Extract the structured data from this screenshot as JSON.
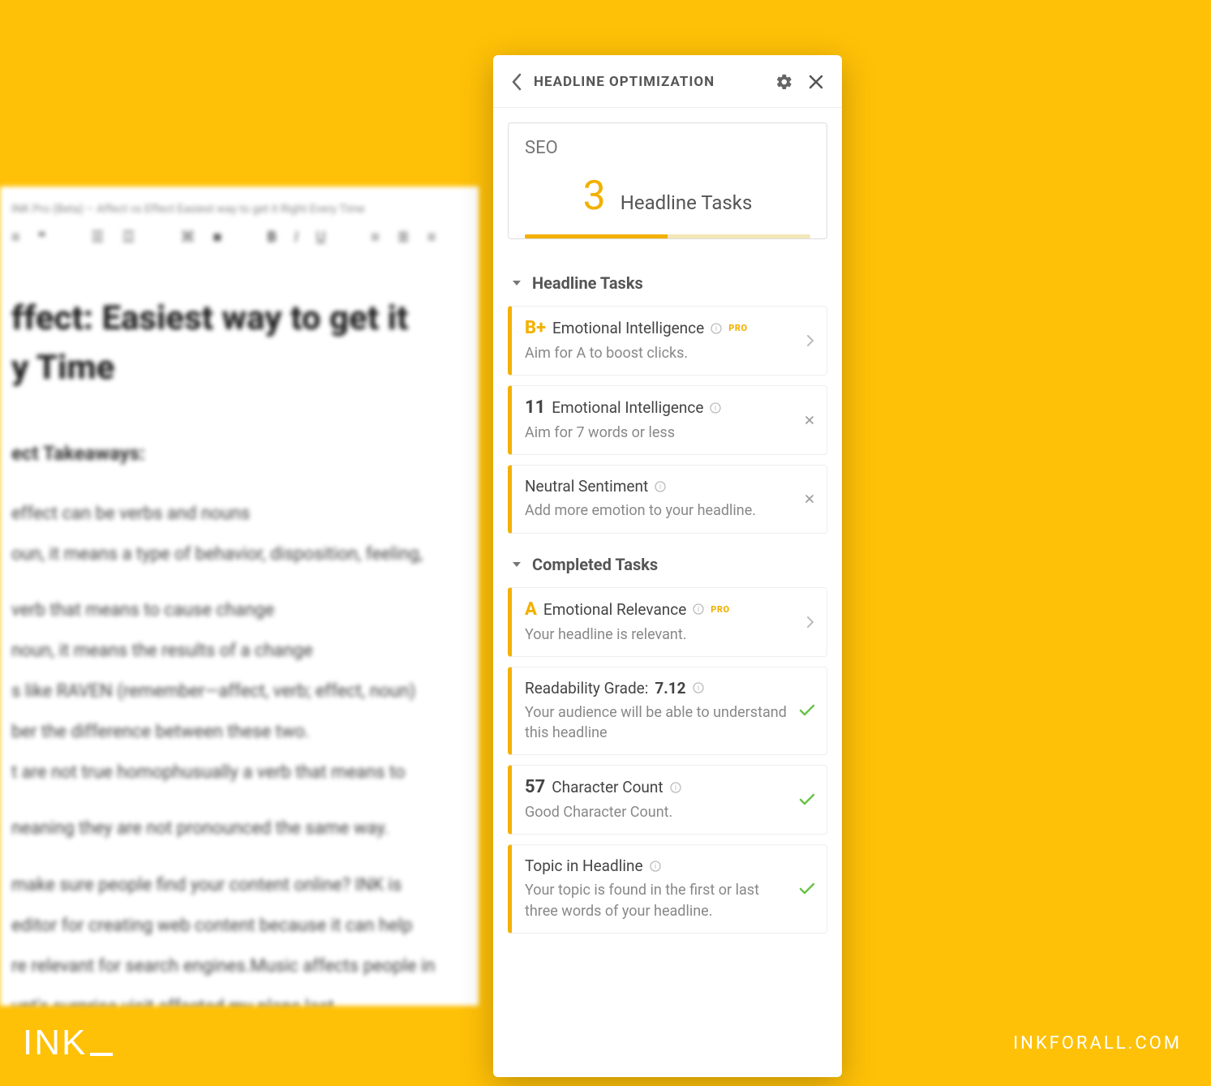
{
  "editor": {
    "window_title": "INK Pro (Beta) – Affect vs Effect Easiest way to get it Right Every Time",
    "heading": "ffect: Easiest way to get it\ny Time",
    "subheading": "ect Takeaways:",
    "lines": [
      "effect can be verbs and nouns",
      "oun, it means a type of behavior, disposition, feeling,",
      "verb that means to cause change",
      "noun, it means the results of a change",
      "s like RAVEN (remember—affect, verb; effect, noun)",
      "ber the difference between these two.",
      "t are not true homophusually a verb that means to",
      "neaning they are not pronounced the same way.",
      " make sure people find your content online? INK is",
      "editor for creating web content because it can help",
      "re relevant for search engines.Music affects people in",
      "unt's surprise visit affected my plans last"
    ]
  },
  "panel": {
    "title": "HEADLINE OPTIMIZATION",
    "seo_label": "SEO",
    "task_count": "3",
    "task_count_label": "Headline Tasks",
    "progress_pct": 50,
    "sections": {
      "pending": "Headline Tasks",
      "completed": "Completed Tasks"
    },
    "pending": [
      {
        "grade": "B+",
        "grade_color": "gold",
        "name": "Emotional Intelligence",
        "pro": true,
        "desc": "Aim for A to boost clicks.",
        "action": "chevron"
      },
      {
        "grade": "11",
        "grade_color": "",
        "name": "Emotional Intelligence",
        "pro": false,
        "desc": "Aim for 7 words or less",
        "action": "x"
      },
      {
        "grade": "",
        "name": "Neutral Sentiment",
        "pro": false,
        "desc": "Add more emotion to your headline.",
        "action": "x"
      }
    ],
    "completed": [
      {
        "grade": "A",
        "grade_color": "gold",
        "name": "Emotional Relevance",
        "pro": true,
        "desc": "Your headline is relevant.",
        "action": "chevron"
      },
      {
        "label_pre": "Readability Grade: ",
        "value": "7.12",
        "desc": "Your audience will be able to understand this headline",
        "action": "check"
      },
      {
        "grade": "57",
        "name": "Character Count",
        "desc": "Good Character Count.",
        "action": "check"
      },
      {
        "name": "Topic in Headline",
        "desc": "Your topic is found in the first or last three words of your headline.",
        "action": "check"
      }
    ]
  },
  "brand": {
    "logo": "INK",
    "url": "INKFORALL.COM"
  }
}
